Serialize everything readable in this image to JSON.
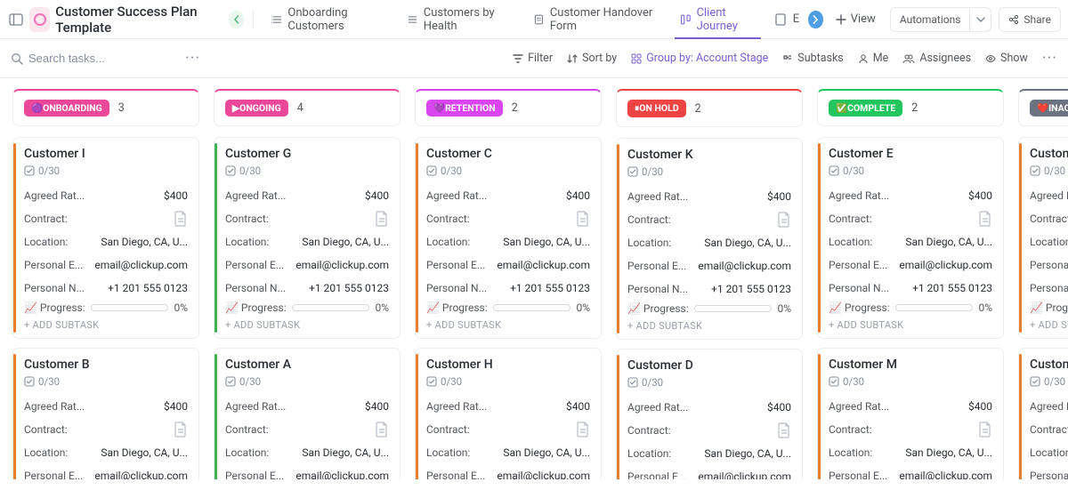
{
  "header": {
    "title": "Customer Success Plan Template",
    "tabs": [
      {
        "label": "Onboarding Customers",
        "active": false
      },
      {
        "label": "Customers by Health",
        "active": false
      },
      {
        "label": "Customer Handover Form",
        "active": false
      },
      {
        "label": "Client Journey",
        "active": true
      },
      {
        "label": "E",
        "active": false
      }
    ],
    "view_label": "View",
    "automations_label": "Automations",
    "share_label": "Share"
  },
  "filterbar": {
    "search_placeholder": "Search tasks...",
    "filter": "Filter",
    "sort": "Sort by",
    "groupby": "Group by: Account Stage",
    "subtasks": "Subtasks",
    "me": "Me",
    "assignees": "Assignees",
    "show": "Show"
  },
  "fields": {
    "rate": "Agreed Rat...",
    "contract": "Contract:",
    "location": "Location:",
    "email": "Personal E...",
    "phone": "Personal N...",
    "progress_prefix": "📈 Progress:",
    "progress_val": "0%",
    "add_subtask": "+ ADD SUBTASK",
    "checklist": "0/30"
  },
  "values": {
    "rate": "$400",
    "location": "San Diego, CA, U...",
    "email": "email@clickup.com",
    "phone": "+1 201 555 0123"
  },
  "columns": [
    {
      "stage": "🟣ONBOARDING",
      "count": "3",
      "color": "#ec4899",
      "cards": [
        {
          "name": "Customer I",
          "bar": "#e97f2e"
        },
        {
          "name": "Customer B",
          "bar": "#e97f2e"
        }
      ]
    },
    {
      "stage": "▶ONGOING",
      "count": "4",
      "color": "#ec4899",
      "cards": [
        {
          "name": "Customer G",
          "bar": "#3fb24f"
        },
        {
          "name": "Customer A",
          "bar": "#3fb24f"
        }
      ]
    },
    {
      "stage": "💜RETENTION",
      "count": "2",
      "color": "#d946ef",
      "cards": [
        {
          "name": "Customer C",
          "bar": "#e97f2e"
        },
        {
          "name": "Customer H",
          "bar": "#e97f2e"
        }
      ]
    },
    {
      "stage": "⏸ON HOLD",
      "count": "2",
      "color": "#ef4444",
      "cards": [
        {
          "name": "Customer K",
          "bar": "#e97f2e"
        },
        {
          "name": "Customer D",
          "bar": "#e97f2e"
        }
      ]
    },
    {
      "stage": "✅COMPLETE",
      "count": "2",
      "color": "#22c55e",
      "cards": [
        {
          "name": "Customer E",
          "bar": "#e97f2e"
        },
        {
          "name": "Customer M",
          "bar": "#e97f2e"
        }
      ]
    },
    {
      "stage": "❤️INACTI",
      "count": "",
      "color": "#6b7280",
      "cards": [
        {
          "name": "Custome",
          "bar": "#e97f2e"
        },
        {
          "name": "Custome",
          "bar": "#e97f2e"
        }
      ]
    }
  ]
}
